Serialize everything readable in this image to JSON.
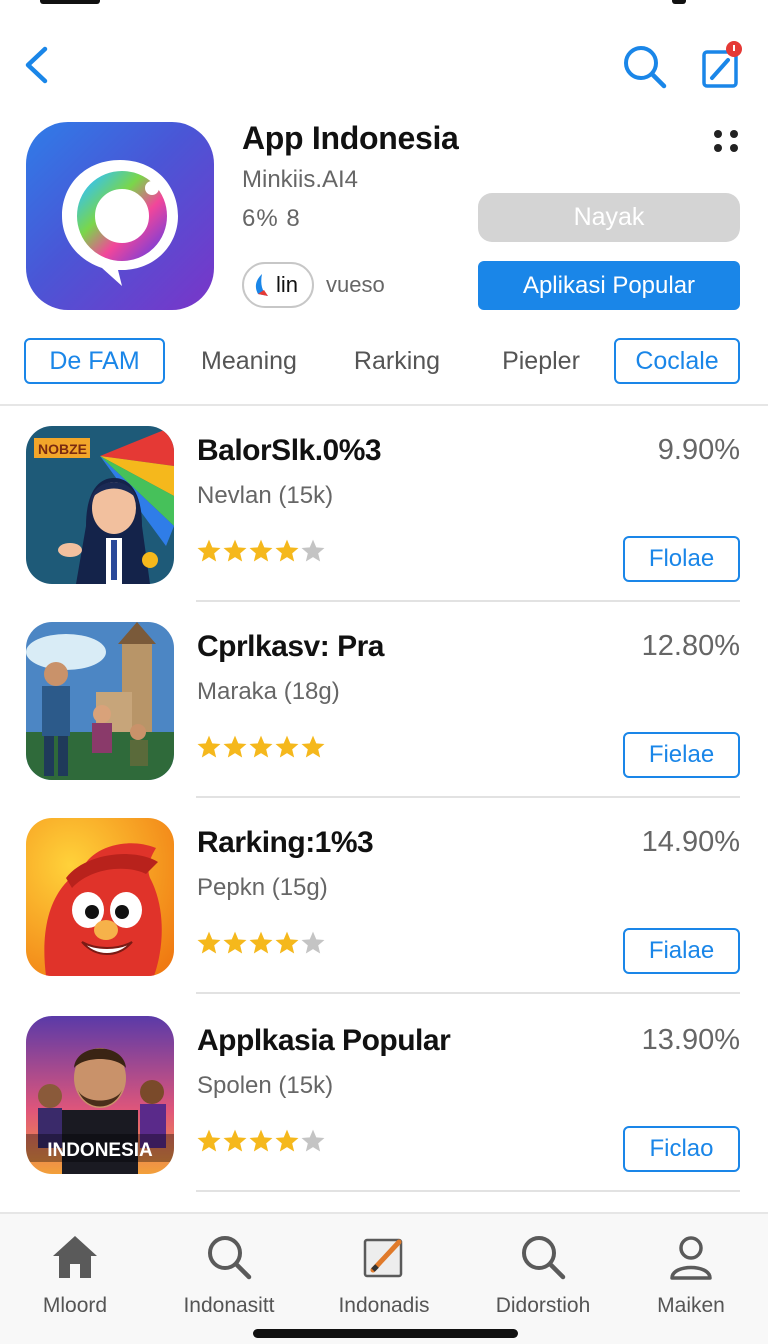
{
  "nav": {
    "back_icon": "chevron-left-icon",
    "search_icon": "search-icon",
    "compose_icon": "compose-icon",
    "accent": "#1a86e8"
  },
  "header": {
    "title": "App Indonesia",
    "developer": "Minkiis.AI4",
    "meta": "6%  8",
    "chip_label": "lin",
    "chip_sub": "vueso",
    "primary_disabled_label": "Nayak",
    "primary_label": "Aplikasi Popular"
  },
  "tabs": [
    {
      "label": "De FAM",
      "style": "boxed"
    },
    {
      "label": "Meaning",
      "style": "plain"
    },
    {
      "label": "Rarking",
      "style": "plain"
    },
    {
      "label": "Piepler",
      "style": "plain"
    },
    {
      "label": "Coclale",
      "style": "boxed"
    }
  ],
  "apps": [
    {
      "title": "BalorSlk.0%3",
      "subtitle": "Nevlan (15k)",
      "percent": "9.90%",
      "rating": 4,
      "button": "Flolae",
      "icon_text": "NOBZE"
    },
    {
      "title": "Cprlkasv: Pra",
      "subtitle": "Maraka (18g)",
      "percent": "12.80%",
      "rating": 5,
      "button": "Fielae",
      "icon_text": ""
    },
    {
      "title": "Rarking:1%3",
      "subtitle": "Pepkn (15g)",
      "percent": "14.90%",
      "rating": 4,
      "button": "Fialae",
      "icon_text": ""
    },
    {
      "title": "Applkasia Popular",
      "subtitle": "Spolen (15k)",
      "percent": "13.90%",
      "rating": 4,
      "button": "Ficlao",
      "icon_text": "INDONESIA"
    }
  ],
  "tabbar": [
    {
      "label": "Mloord",
      "icon": "home-icon"
    },
    {
      "label": "Indonasitt",
      "icon": "search-icon"
    },
    {
      "label": "Indonadis",
      "icon": "notepad-icon"
    },
    {
      "label": "Didorstioh",
      "icon": "search-icon"
    },
    {
      "label": "Maiken",
      "icon": "person-icon"
    }
  ],
  "colors": {
    "star_filled": "#f5b81c",
    "star_empty": "#c4c4c4",
    "badge_red": "#e53935"
  }
}
